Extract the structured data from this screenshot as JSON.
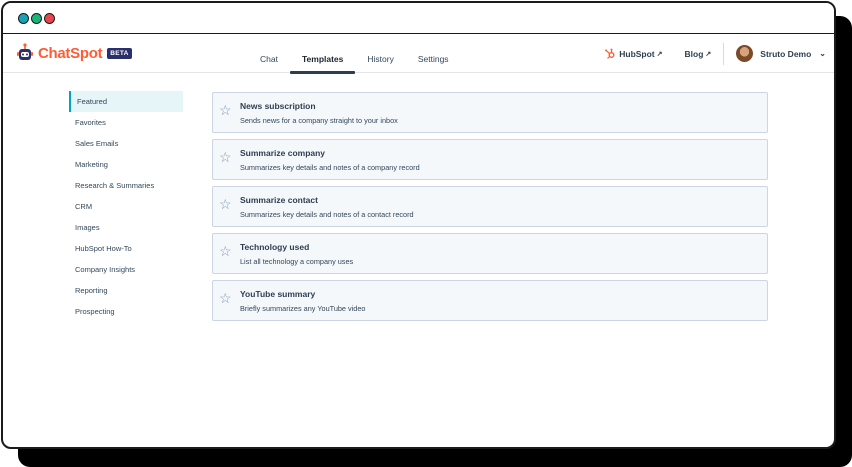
{
  "window": {
    "dots": [
      "#17a2b8",
      "#18b57a",
      "#e8464f"
    ]
  },
  "app": {
    "name": "ChatSpot",
    "badge": "BETA",
    "brand_color": "#ff5c35"
  },
  "tabs": [
    {
      "label": "Chat",
      "active": false
    },
    {
      "label": "Templates",
      "active": true
    },
    {
      "label": "History",
      "active": false
    },
    {
      "label": "Settings",
      "active": false
    }
  ],
  "right_nav": {
    "hubspot": "HubSpot",
    "blog": "Blog",
    "user": "Struto Demo"
  },
  "sidebar": {
    "items": [
      {
        "label": "Featured"
      },
      {
        "label": "Favorites"
      },
      {
        "label": "Sales Emails"
      },
      {
        "label": "Marketing"
      },
      {
        "label": "Research & Summaries"
      },
      {
        "label": "CRM"
      },
      {
        "label": "Images"
      },
      {
        "label": "HubSpot How-To"
      },
      {
        "label": "Company Insights"
      },
      {
        "label": "Reporting"
      },
      {
        "label": "Prospecting"
      }
    ]
  },
  "templates": [
    {
      "title": "News subscription",
      "description": "Sends news for a company straight to your inbox"
    },
    {
      "title": "Summarize company",
      "description": "Summarizes key details and notes of a company record"
    },
    {
      "title": "Summarize contact",
      "description": "Summarizes key details and notes of a contact record"
    },
    {
      "title": "Technology used",
      "description": "List all technology a company uses"
    },
    {
      "title": "YouTube summary",
      "description": "Briefly summarizes any YouTube video"
    }
  ]
}
